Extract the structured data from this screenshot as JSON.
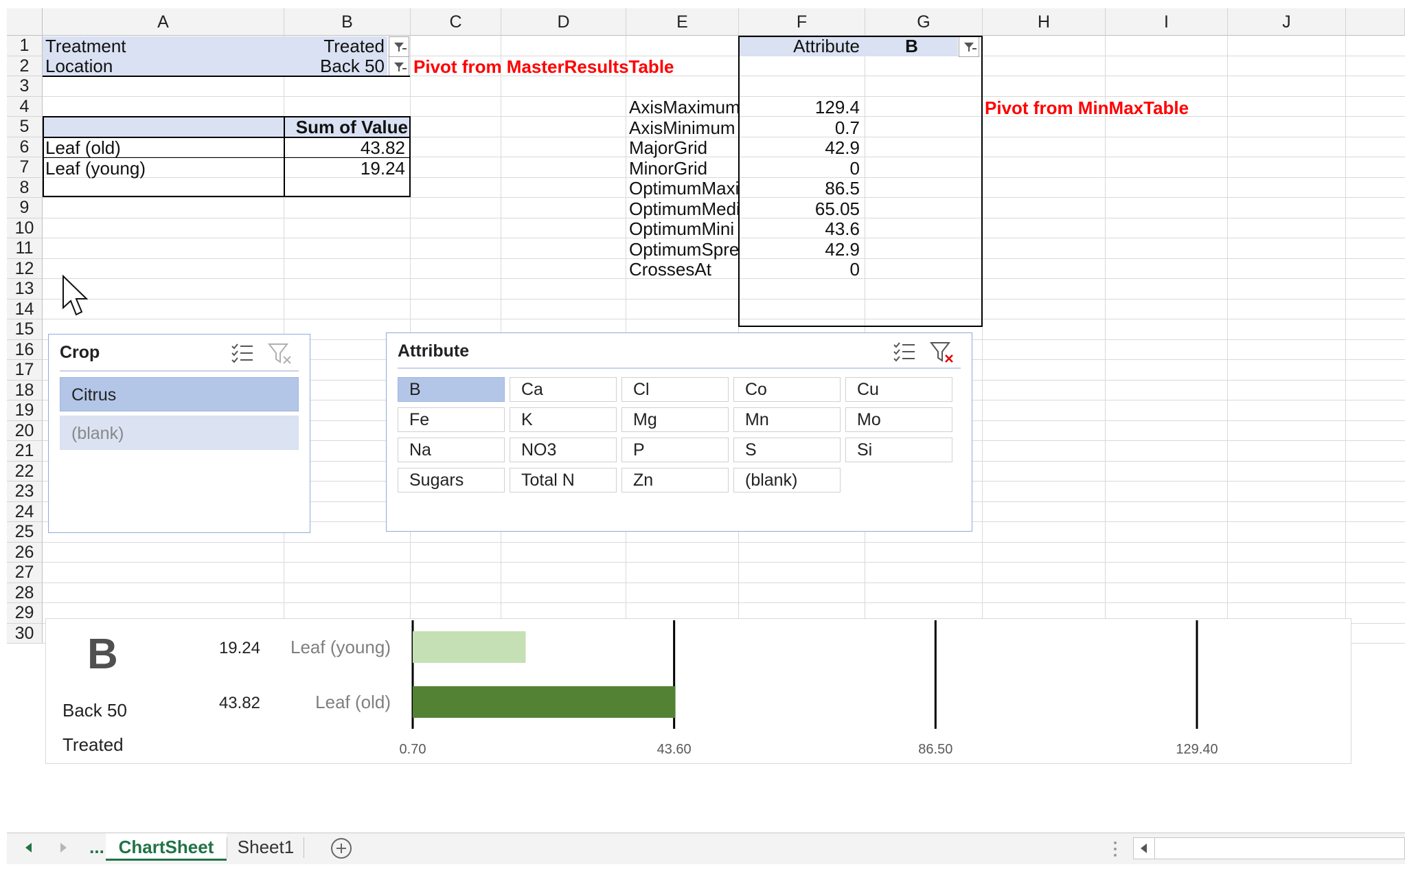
{
  "columns": [
    "A",
    "B",
    "C",
    "D",
    "E",
    "F",
    "G",
    "H",
    "I",
    "J"
  ],
  "rows": [
    "1",
    "2",
    "3",
    "4",
    "5",
    "6",
    "7",
    "8",
    "9",
    "10",
    "11",
    "12",
    "13",
    "14",
    "15",
    "16",
    "17",
    "18",
    "19",
    "20",
    "21",
    "22",
    "23",
    "24",
    "25",
    "26",
    "27",
    "28",
    "29",
    "30"
  ],
  "pivot1": {
    "filter_treatment_label": "Treatment",
    "filter_treatment_value": "Treated",
    "filter_location_label": "Location",
    "filter_location_value": "Back 50",
    "note": "Pivot from MasterResultsTable",
    "value_header": "Sum of Value",
    "rows": [
      {
        "label": "Leaf (old)",
        "value": "43.82"
      },
      {
        "label": "Leaf (young)",
        "value": "19.24"
      }
    ]
  },
  "pivot2": {
    "filter_label": "Attribute",
    "filter_value": "B",
    "note": "Pivot from MinMaxTable",
    "rows": [
      {
        "label": "AxisMaximum",
        "value": "129.4"
      },
      {
        "label": "AxisMinimum",
        "value": "0.7"
      },
      {
        "label": "MajorGrid",
        "value": "42.9"
      },
      {
        "label": "MinorGrid",
        "value": "0"
      },
      {
        "label": "OptimumMaxi",
        "value": "86.5"
      },
      {
        "label": "OptimumMedi",
        "value": "65.05"
      },
      {
        "label": "OptimumMini",
        "value": "43.6"
      },
      {
        "label": "OptimumSprea",
        "value": "42.9"
      },
      {
        "label": "CrossesAt",
        "value": "0"
      }
    ]
  },
  "slicer_crop": {
    "title": "Crop",
    "items": [
      "Citrus",
      "(blank)"
    ]
  },
  "slicer_attribute": {
    "title": "Attribute",
    "items": [
      "B",
      "Ca",
      "Cl",
      "Co",
      "Cu",
      "Fe",
      "K",
      "Mg",
      "Mn",
      "Mo",
      "Na",
      "NO3",
      "P",
      "S",
      "Si",
      "Sugars",
      "Total N",
      "Zn",
      "(blank)"
    ]
  },
  "chart_panel": {
    "big_label": "B",
    "location": "Back 50",
    "treatment": "Treated"
  },
  "chart_data": {
    "type": "bar",
    "orientation": "horizontal",
    "categories": [
      "Leaf (young)",
      "Leaf (old)"
    ],
    "values": [
      19.24,
      43.82
    ],
    "value_labels": [
      "19.24",
      "43.82"
    ],
    "bar_colors": [
      "#c5e0b4",
      "#548235"
    ],
    "xlim": [
      0.7,
      129.4
    ],
    "major_unit": 42.9,
    "x_ticks": [
      "0.70",
      "43.60",
      "86.50",
      "129.40"
    ],
    "grid": true
  },
  "tabs": {
    "ellipsis": "...",
    "items": [
      "ChartSheet",
      "Sheet1"
    ],
    "active": "ChartSheet"
  },
  "colors": {
    "pivot_header": "#d9e1f2",
    "note_red": "#ff0000",
    "slicer_selected": "#b4c6e7",
    "tab_active": "#217346"
  }
}
